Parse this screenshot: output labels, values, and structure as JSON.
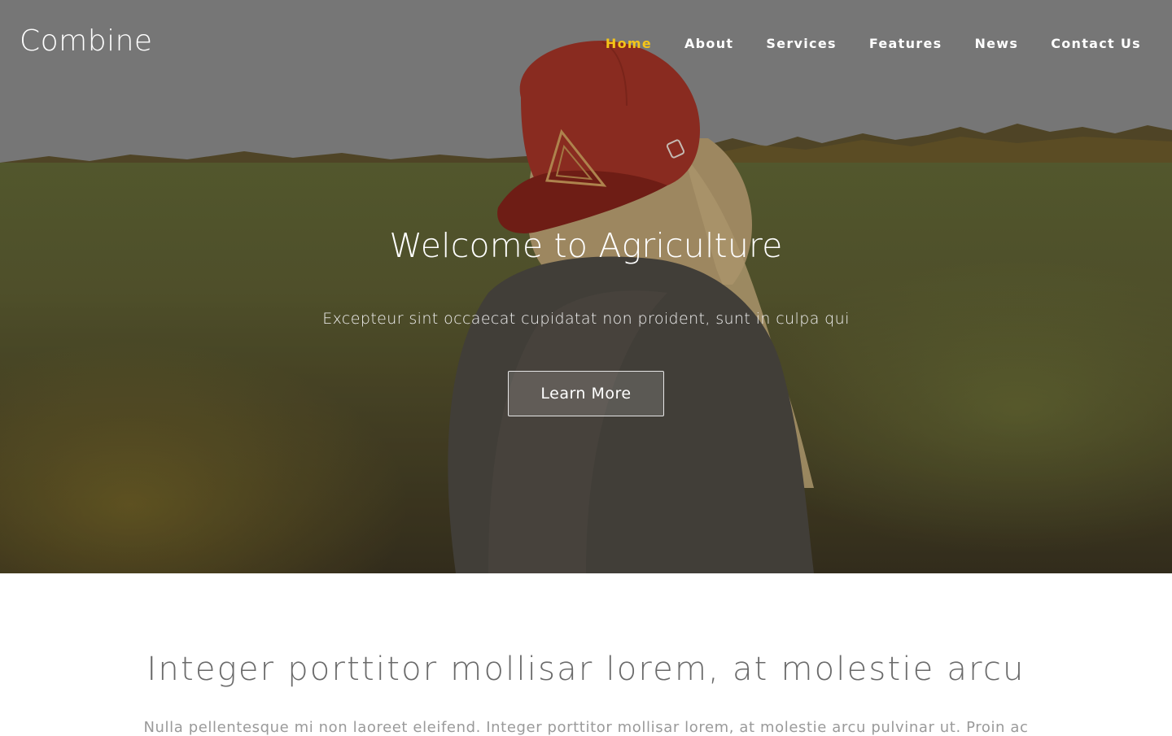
{
  "header": {
    "logo": "Combine",
    "nav": [
      {
        "label": "Home",
        "active": true
      },
      {
        "label": "About",
        "active": false
      },
      {
        "label": "Services",
        "active": false
      },
      {
        "label": "Features",
        "active": false
      },
      {
        "label": "News",
        "active": false
      },
      {
        "label": "Contact Us",
        "active": false
      }
    ],
    "active_color": "#f5c518"
  },
  "hero": {
    "title": "Welcome to Agriculture",
    "subtitle": "Excepteur sint occaecat cupidatat non proident, sunt in culpa qui",
    "button_label": "Learn More",
    "image": "woman-in-red-cap-field-photo"
  },
  "intro": {
    "title": "Integer porttitor mollisar lorem, at molestie arcu",
    "text": "Nulla pellentesque mi non laoreet eleifend. Integer porttitor mollisar lorem, at molestie arcu pulvinar ut. Proin ac"
  }
}
